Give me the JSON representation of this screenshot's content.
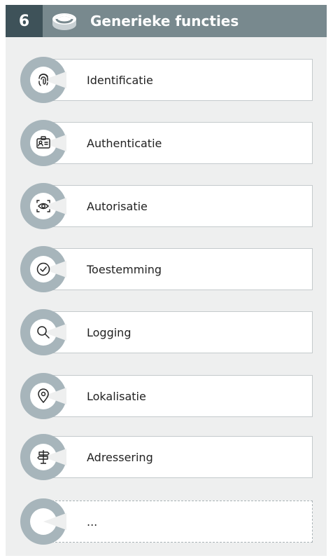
{
  "header": {
    "number": "6",
    "title": "Generieke functies",
    "logo_icon": "cylinder-logo-icon"
  },
  "items": [
    {
      "label": "Identificatie",
      "icon": "fingerprint-icon"
    },
    {
      "label": "Authenticatie",
      "icon": "id-card-icon"
    },
    {
      "label": "Autorisatie",
      "icon": "eye-scan-icon"
    },
    {
      "label": "Toestemming",
      "icon": "check-circle-icon"
    },
    {
      "label": "Logging",
      "icon": "search-icon"
    },
    {
      "label": "Lokalisatie",
      "icon": "location-pin-icon"
    },
    {
      "label": "Adressering",
      "icon": "signpost-icon"
    },
    {
      "label": "...",
      "icon": "none"
    }
  ],
  "colors": {
    "header_dark": "#3e5259",
    "header_light": "#78898e",
    "ring": "#a7b5bb",
    "panel_bg": "#eeefef"
  }
}
